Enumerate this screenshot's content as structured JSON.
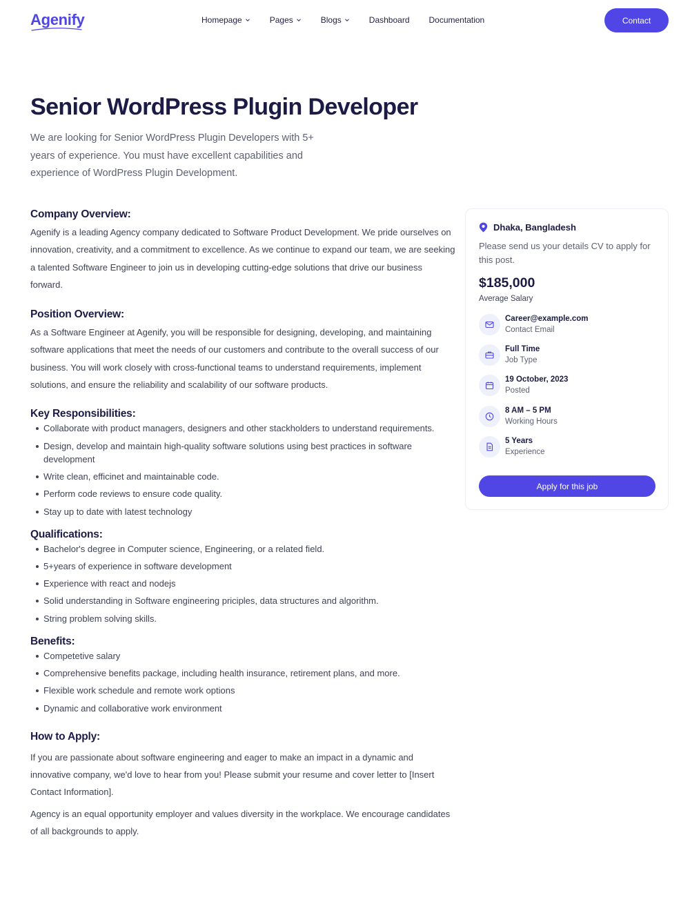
{
  "nav": {
    "logo": "Agenify",
    "menu": [
      {
        "label": "Homepage",
        "has_dropdown": true
      },
      {
        "label": "Pages",
        "has_dropdown": true
      },
      {
        "label": "Blogs",
        "has_dropdown": true
      },
      {
        "label": "Dashboard",
        "has_dropdown": false
      },
      {
        "label": "Documentation",
        "has_dropdown": false
      }
    ],
    "contact_label": "Contact"
  },
  "hero": {
    "title": "Senior WordPress Plugin Developer",
    "description": "We are looking for Senior WordPress Plugin Developers with 5+ years of experience. You must have excellent capabilities and experience of WordPress Plugin Development."
  },
  "sections": {
    "company": {
      "heading": "Company Overview:",
      "text": "Agenify is a leading Agency company dedicated to Software Product Development. We pride ourselves on innovation, creativity, and a commitment to excellence. As we continue to expand our team, we are seeking a talented Software Engineer to join us in developing cutting-edge solutions that drive our business forward."
    },
    "position": {
      "heading": "Position Overview:",
      "text": "As a Software Engineer at Agenify, you will be responsible for designing, developing, and maintaining software applications that meet the needs of our customers and contribute to the overall success of our business. You will work closely with cross-functional teams to understand requirements, implement solutions, and ensure the reliability and scalability of our software products."
    },
    "responsibilities": {
      "heading": "Key Responsibilities:",
      "items": [
        "Collaborate with product managers, designers and other stackholders to understand requirements.",
        "Design, develop and maintain high-quality software solutions using best practices in software development",
        "Write clean, efficinet and maintainable code.",
        "Perform code reviews to ensure code quality.",
        "Stay up to date with latest technology"
      ]
    },
    "qualifications": {
      "heading": "Qualifications:",
      "items": [
        "Bachelor's degree in Computer science, Engineering,  or a related field.",
        "5+years of experience in software development",
        "Experience with react and nodejs",
        "Solid understanding in Software engineering priciples, data structures and algorithm.",
        "String problem solving skills."
      ]
    },
    "benefits": {
      "heading": "Benefits:",
      "items": [
        "Competetive salary",
        "Comprehensive benefits package, including health insurance, retirement plans, and more.",
        "Flexible work schedule and remote work options",
        "Dynamic and collaborative work environment"
      ]
    },
    "apply": {
      "heading": "How to Apply:",
      "text1": "If you are passionate about software engineering and eager to make an impact in a dynamic and innovative company, we'd love to hear from you! Please submit your resume and cover letter to [Insert Contact Information].",
      "text2": "Agency is an equal opportunity employer and values diversity in the workplace. We encourage candidates of all backgrounds to apply."
    }
  },
  "card": {
    "location": "Dhaka, Bangladesh",
    "description": "Please send us your details CV to apply for this post.",
    "salary": "$185,000",
    "salary_label": "Average Salary",
    "info": [
      {
        "value": "Career@example.com",
        "label": "Contact Email",
        "icon": "mail-icon"
      },
      {
        "value": "Full Time",
        "label": "Job Type",
        "icon": "briefcase-icon"
      },
      {
        "value": "19 October, 2023",
        "label": "Posted",
        "icon": "calendar-icon"
      },
      {
        "value": "8 AM – 5 PM",
        "label": "Working Hours",
        "icon": "clock-icon"
      },
      {
        "value": "5 Years",
        "label": "Experience",
        "icon": "document-icon"
      }
    ],
    "apply_label": "Apply for this job"
  },
  "colors": {
    "accent": "#4f46e5",
    "heading": "#1b1b45",
    "icon_bg": "#eef0fb"
  }
}
